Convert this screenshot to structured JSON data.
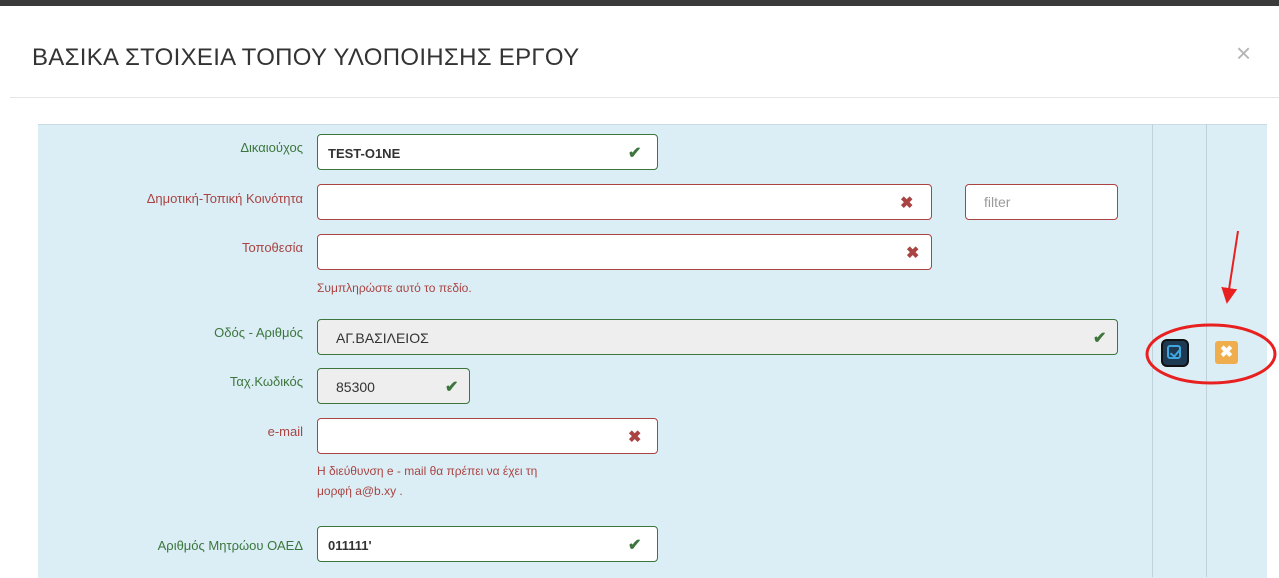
{
  "modal": {
    "title": "ΒΑΣΙΚΑ ΣΤΟΙΧΕΙΑ ΤΟΠΟΥ ΥΛΟΠΟΙΗΣΗΣ ΕΡΓΟΥ",
    "close_label": "×"
  },
  "form": {
    "beneficiary": {
      "label": "Δικαιούχος",
      "value": "TEST-O1NE",
      "status": "valid"
    },
    "community": {
      "label": "Δημοτική-Τοπική Κοινότητα",
      "value": "",
      "status": "invalid",
      "filter_placeholder": "filter"
    },
    "location": {
      "label": "Τοποθεσία",
      "value": "",
      "status": "invalid",
      "error": "Συμπληρώστε αυτό το πεδίο."
    },
    "street": {
      "label": "Οδός - Αριθμός",
      "value": "ΑΓ.ΒΑΣΙΛΕΙΟΣ",
      "status": "valid"
    },
    "postal": {
      "label": "Ταχ.Κωδικός",
      "value": "85300",
      "status": "valid"
    },
    "email": {
      "label": "e-mail",
      "value": "",
      "status": "invalid",
      "error_line1": "Η διεύθυνση e - mail θα πρέπει να έχει τη",
      "error_line2": "μορφή a@b.xy ."
    },
    "oaed": {
      "label": "Αριθμός Μητρώου ΟΑΕΔ",
      "value": "011111'",
      "status": "valid"
    }
  },
  "actions": {
    "edit": "edit-check-icon",
    "cancel_label": "✖"
  },
  "icons": {
    "valid": "✔",
    "invalid": "✖"
  },
  "colors": {
    "valid": "#3c763d",
    "invalid": "#a94442",
    "panel": "#dbeef6",
    "cancel": "#f0ad4e",
    "annotation": "#e8201f"
  }
}
